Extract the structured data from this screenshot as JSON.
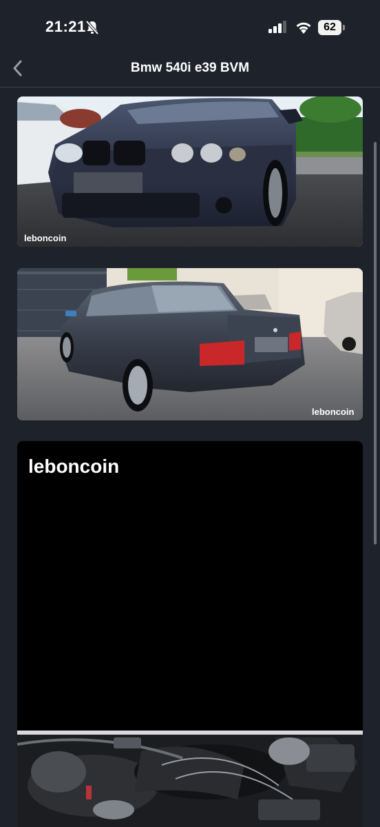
{
  "status_bar": {
    "time": "21:21",
    "battery": "62"
  },
  "nav": {
    "title": "Bmw 540i e39 BVM"
  },
  "photos": {
    "watermark": "leboncoin"
  },
  "icons": {
    "back": "chevron-left-icon",
    "silent": "bell-slash-icon",
    "signal": "cellular-signal-icon",
    "wifi": "wifi-icon"
  }
}
